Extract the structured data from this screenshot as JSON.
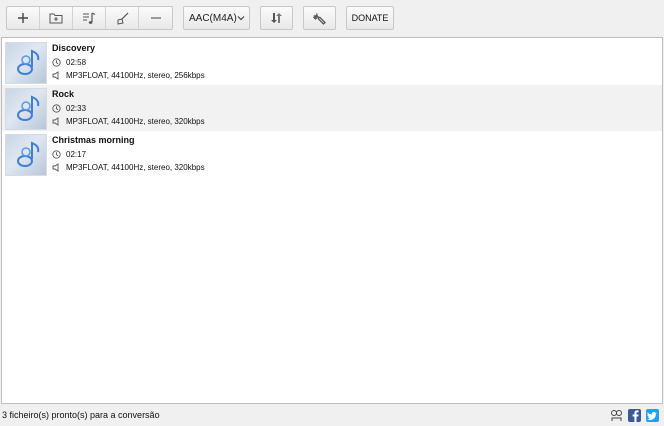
{
  "toolbar": {
    "buttons": [
      {
        "icon": "plus-icon"
      },
      {
        "icon": "add-folder-icon"
      },
      {
        "icon": "music-note-icon"
      },
      {
        "icon": "broom-icon"
      },
      {
        "icon": "minus-icon"
      }
    ],
    "format_value": "AAC(M4A)",
    "convert_icon": "convert-arrows-icon",
    "settings_icon": "wrench-icon",
    "donate_label": "DONATE"
  },
  "files": [
    {
      "title": "Discovery",
      "duration": "02:58",
      "info": "MP3FLOAT, 44100Hz, stereo, 256kbps"
    },
    {
      "title": "Rock",
      "duration": "02:33",
      "info": "MP3FLOAT, 44100Hz, stereo, 320kbps"
    },
    {
      "title": "Christmas morning",
      "duration": "02:17",
      "info": "MP3FLOAT, 44100Hz, stereo, 320kbps"
    }
  ],
  "status": {
    "text": "3 ficheiro(s) pronto(s) para a conversão"
  },
  "colors": {
    "facebook": "#3b5998",
    "twitter": "#1da1f2"
  }
}
